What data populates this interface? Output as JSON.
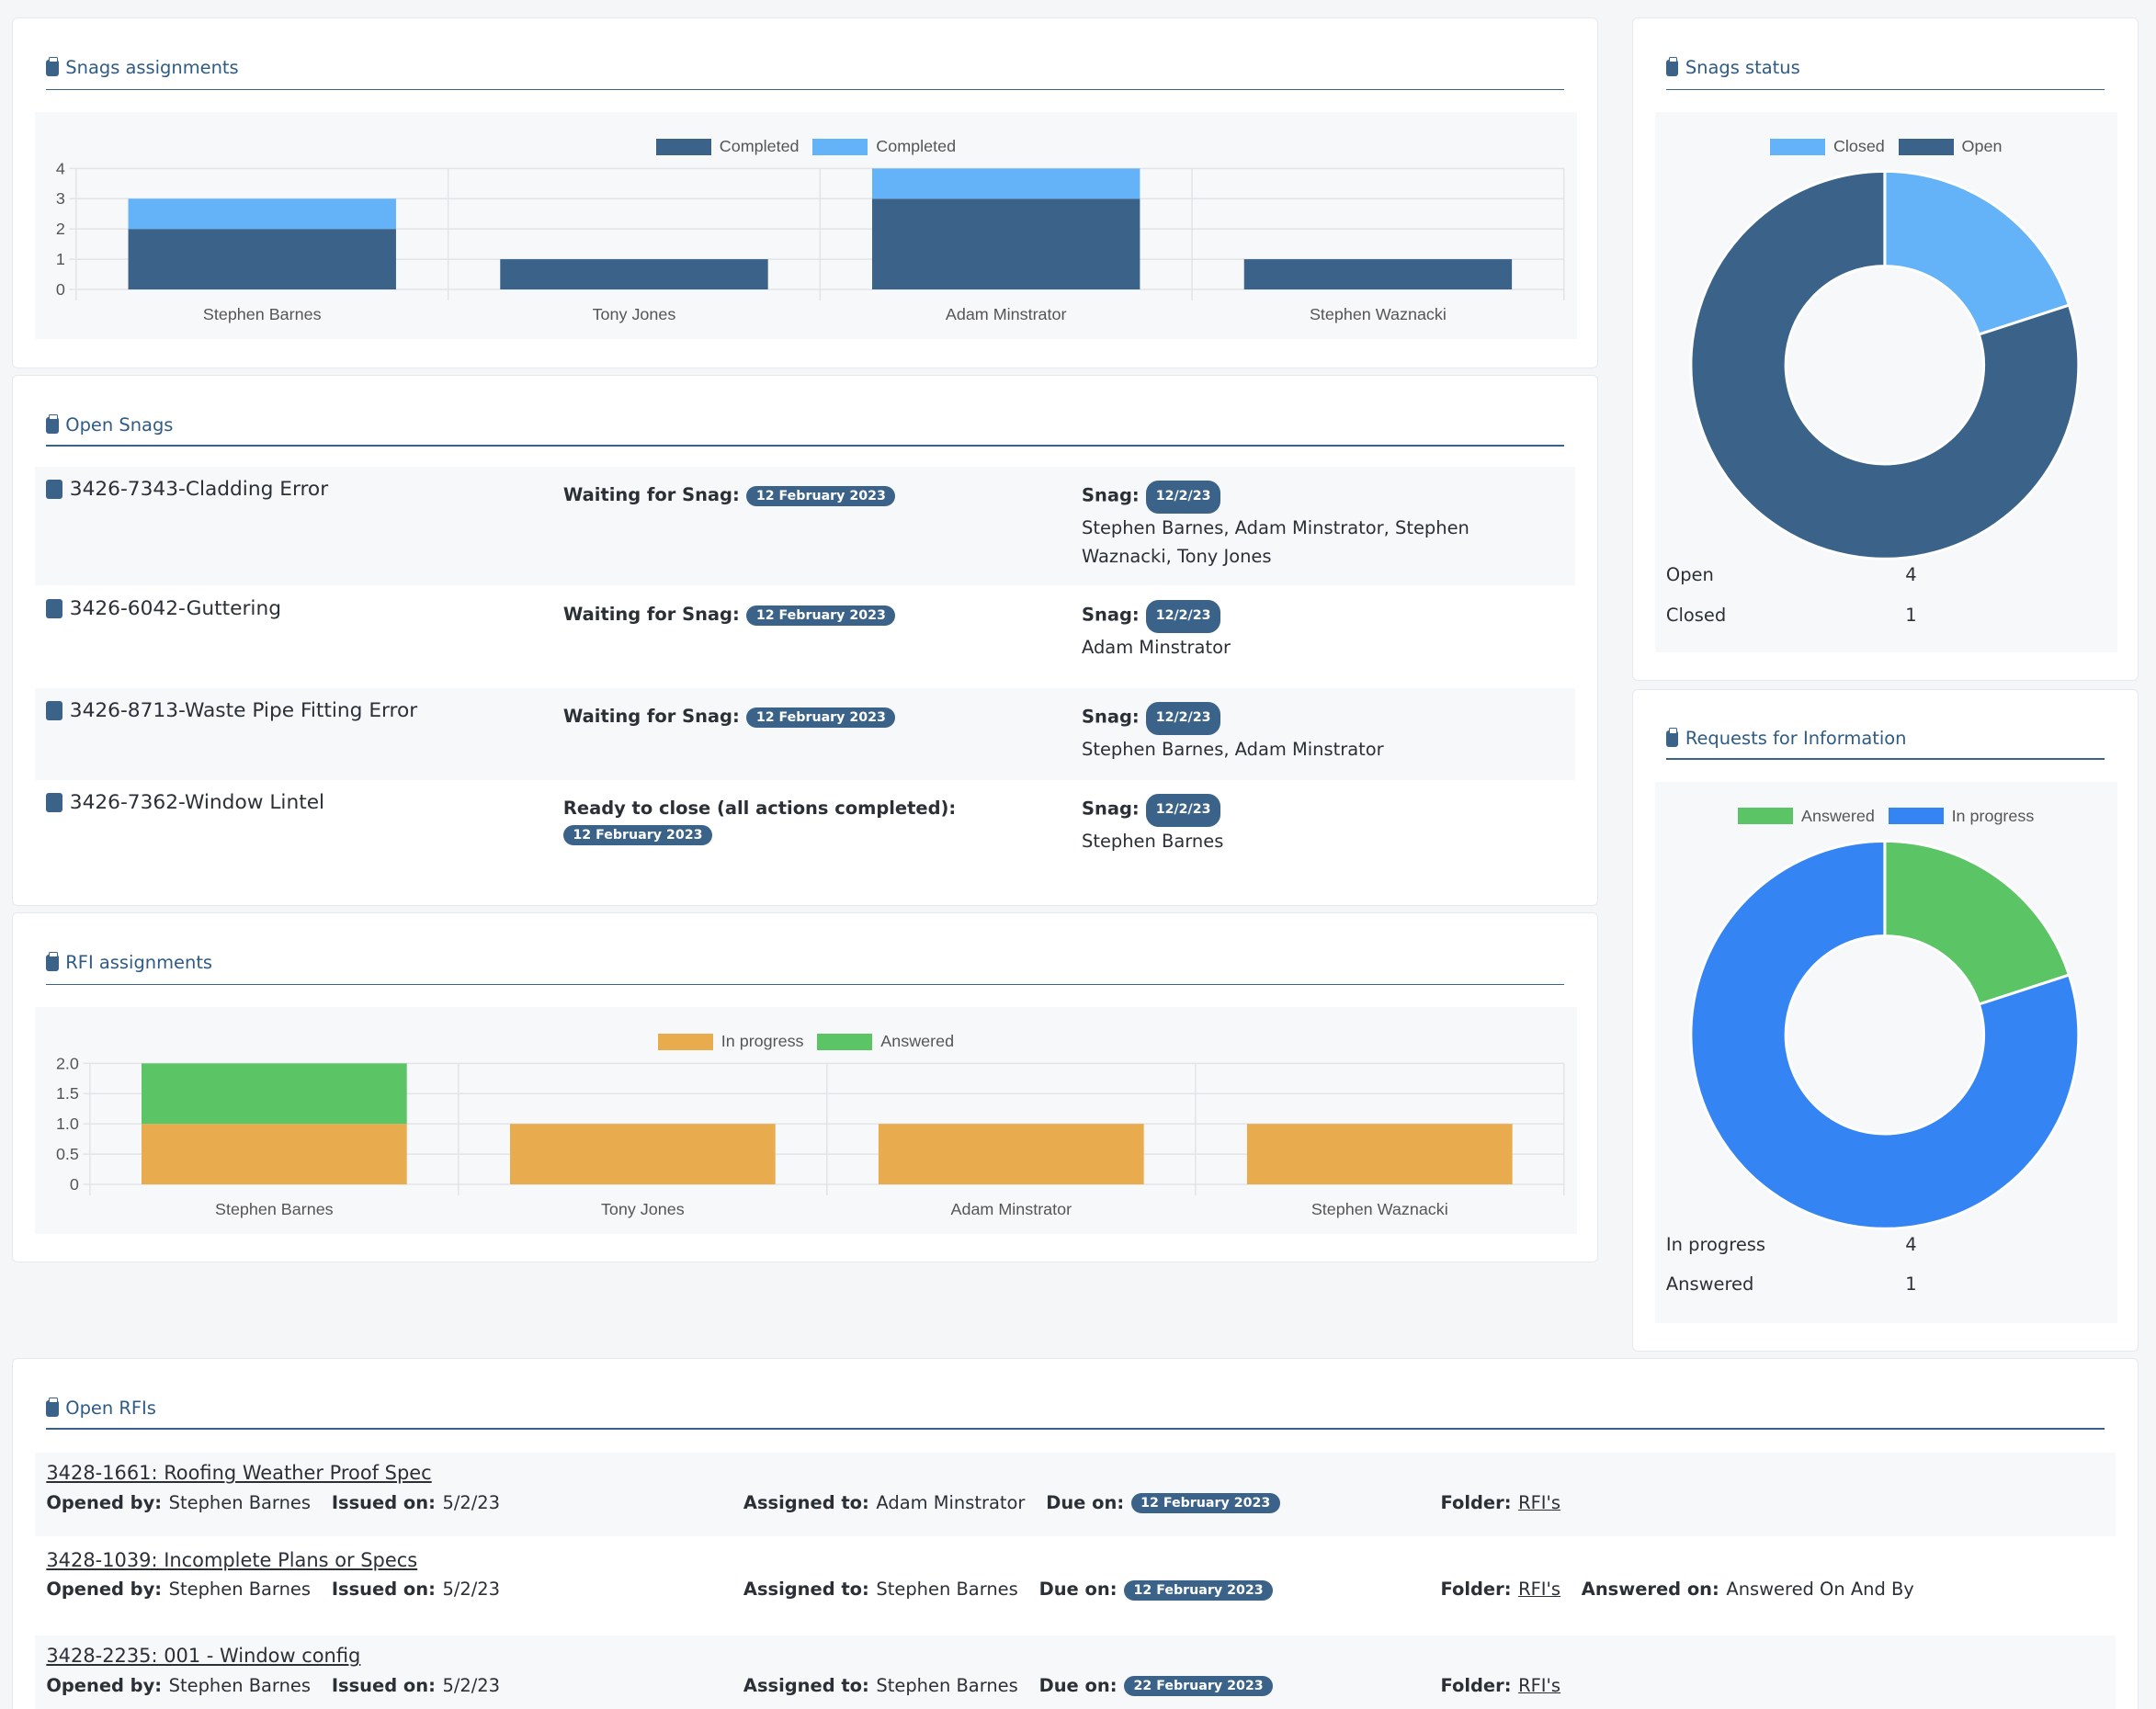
{
  "snag_assignments": {
    "title": "Snags assignments",
    "chart_data": {
      "type": "bar",
      "stacked": true,
      "categories": [
        "Stephen Barnes",
        "Tony Jones",
        "Adam Minstrator",
        "Stephen Waznacki"
      ],
      "series": [
        {
          "name": "Completed",
          "color": "#3b6389",
          "values": [
            2,
            1,
            3,
            1
          ]
        },
        {
          "name": "Completed",
          "color": "#64b2f7",
          "values": [
            1,
            0,
            1,
            0
          ]
        }
      ],
      "ylim": [
        0,
        4
      ],
      "yticks": [
        "0",
        "1",
        "2",
        "3",
        "4"
      ],
      "grid": true,
      "legend": "top"
    }
  },
  "open_snags": {
    "title": "Open Snags",
    "snag_label": "Snag:",
    "items": [
      {
        "title": "3426-7343-Cladding Error",
        "status": "Waiting for Snag:",
        "date": "12 February 2023",
        "snag_date": "12/2/23",
        "assignees": "Stephen Barnes, Adam Minstrator, Stephen Waznacki, Tony Jones"
      },
      {
        "title": "3426-6042-Guttering",
        "status": "Waiting for Snag:",
        "date": "12 February 2023",
        "snag_date": "12/2/23",
        "assignees": "Adam Minstrator"
      },
      {
        "title": "3426-8713-Waste Pipe Fitting Error",
        "status": "Waiting for Snag:",
        "date": "12 February 2023",
        "snag_date": "12/2/23",
        "assignees": "Stephen Barnes, Adam Minstrator"
      },
      {
        "title": "3426-7362-Window Lintel",
        "status": "Ready to close (all actions completed):",
        "date": "12 February 2023",
        "snag_date": "12/2/23",
        "assignees": "Stephen Barnes"
      }
    ]
  },
  "rfi_assignments": {
    "title": "RFI assignments",
    "chart_data": {
      "type": "bar",
      "stacked": true,
      "categories": [
        "Stephen Barnes",
        "Tony Jones",
        "Adam Minstrator",
        "Stephen Waznacki"
      ],
      "series": [
        {
          "name": "In progress",
          "color": "#e8ab4e",
          "values": [
            1,
            1,
            1,
            1
          ]
        },
        {
          "name": "Answered",
          "color": "#5bc465",
          "values": [
            1,
            0,
            0,
            0
          ]
        }
      ],
      "ylim": [
        0,
        2
      ],
      "yticks": [
        "0",
        "0.5",
        "1.0",
        "1.5",
        "2.0"
      ],
      "grid": true,
      "legend": "top"
    }
  },
  "snags_status": {
    "title": "Snags status",
    "chart_data": {
      "type": "pie",
      "donut": true,
      "labels": [
        "Closed",
        "Open"
      ],
      "values": [
        1,
        4
      ],
      "colors": [
        "#64b2f7",
        "#3b6389"
      ],
      "legend": "top"
    },
    "rows": [
      {
        "label": "Open",
        "value": "4"
      },
      {
        "label": "Closed",
        "value": "1"
      }
    ]
  },
  "rfi_status": {
    "title": "Requests for Information",
    "chart_data": {
      "type": "pie",
      "donut": true,
      "labels": [
        "Answered",
        "In progress"
      ],
      "values": [
        1,
        4
      ],
      "colors": [
        "#5bc465",
        "#3584f4"
      ],
      "legend": "top"
    },
    "rows": [
      {
        "label": "In progress",
        "value": "4"
      },
      {
        "label": "Answered",
        "value": "1"
      }
    ]
  },
  "open_rfis": {
    "title": "Open RFIs",
    "labels": {
      "opened_by": "Opened by:",
      "issued_on": "Issued on:",
      "assigned_to": "Assigned to:",
      "due_on": "Due on:",
      "folder": "Folder:",
      "answered_on": "Answered on:"
    },
    "items": [
      {
        "title": "3428-1661: Roofing Weather Proof Spec",
        "opened_by": "Stephen Barnes",
        "issued_on": "5/2/23",
        "assigned_to": "Adam Minstrator",
        "due_on": "12 February 2023",
        "folder": "RFI's",
        "answered_on": null
      },
      {
        "title": "3428-1039: Incomplete Plans or Specs",
        "opened_by": "Stephen Barnes",
        "issued_on": "5/2/23",
        "assigned_to": "Stephen Barnes",
        "due_on": "12 February 2023",
        "folder": "RFI's",
        "answered_on": "Answered On And By"
      },
      {
        "title": "3428-2235: 001 - Window config",
        "opened_by": "Stephen Barnes",
        "issued_on": "5/2/23",
        "assigned_to": "Stephen Barnes",
        "due_on": "22 February 2023",
        "folder": "RFI's",
        "answered_on": null
      }
    ]
  }
}
